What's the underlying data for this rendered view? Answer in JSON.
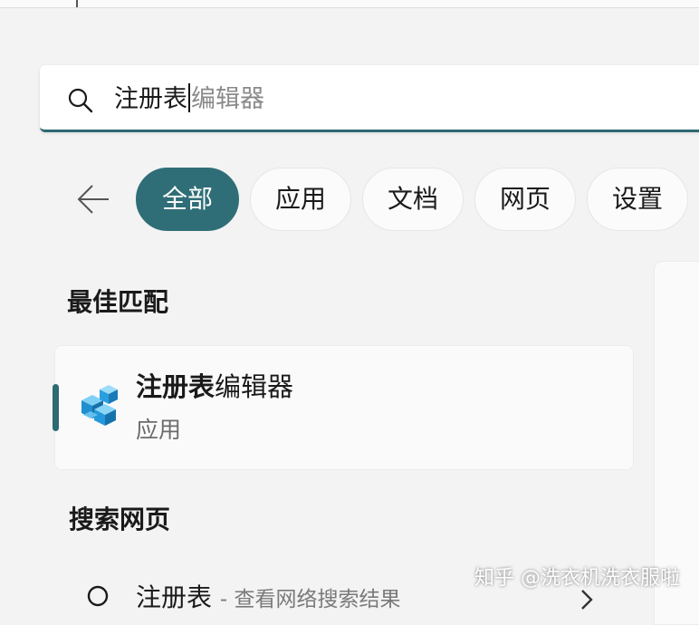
{
  "search": {
    "typed_text": "注册表",
    "suggestion_text": "编辑器"
  },
  "filters": [
    {
      "label": "全部",
      "active": true
    },
    {
      "label": "应用",
      "active": false
    },
    {
      "label": "文档",
      "active": false
    },
    {
      "label": "网页",
      "active": false
    },
    {
      "label": "设置",
      "active": false
    }
  ],
  "best_match": {
    "section_title": "最佳匹配",
    "app_name_bold": "注册表",
    "app_name_rest": "编辑器",
    "app_type": "应用",
    "icon": "registry-editor-icon"
  },
  "web_search": {
    "section_title": "搜索网页",
    "query": "注册表",
    "subtitle": "- 查看网络搜索结果"
  },
  "watermark": "知乎 @洗衣机洗衣服啦",
  "colors": {
    "accent": "#2f6e77",
    "background": "#f3f3f3"
  }
}
